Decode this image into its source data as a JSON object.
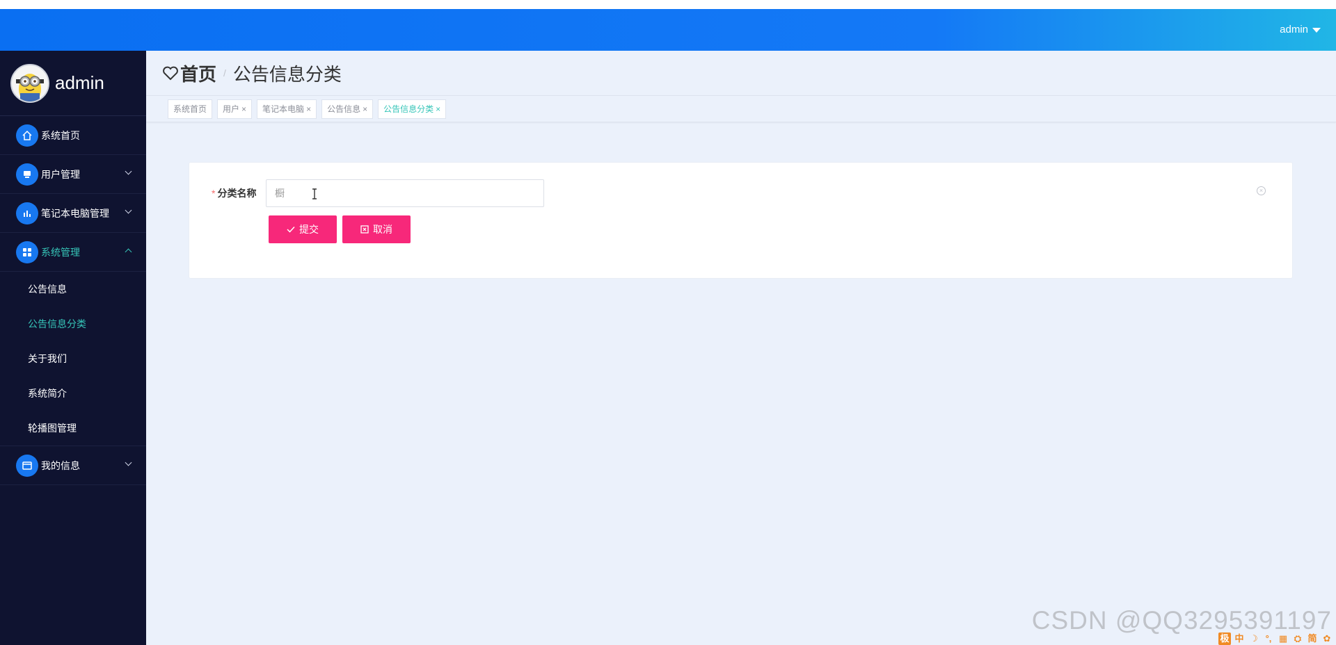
{
  "topbar": {
    "user_label": "admin"
  },
  "sidebar": {
    "profile_name": "admin",
    "items": [
      {
        "label": "系统首页",
        "icon": "home-icon"
      },
      {
        "label": "用户管理",
        "icon": "user-icon"
      },
      {
        "label": "笔记本电脑管理",
        "icon": "chart-icon"
      },
      {
        "label": "系统管理",
        "icon": "grid-icon"
      },
      {
        "label": "我的信息",
        "icon": "card-icon"
      }
    ],
    "submenu": [
      "公告信息",
      "公告信息分类",
      "关于我们",
      "系统简介",
      "轮播图管理"
    ]
  },
  "breadcrumb": {
    "home": "首页",
    "separator": "/",
    "current": "公告信息分类"
  },
  "tabs": [
    {
      "label": "系统首页",
      "closable": false
    },
    {
      "label": "用户",
      "closable": true
    },
    {
      "label": "笔记本电脑",
      "closable": true
    },
    {
      "label": "公告信息",
      "closable": true
    },
    {
      "label": "公告信息分类",
      "closable": true,
      "active": true
    }
  ],
  "tab_close_glyph": "×",
  "form": {
    "field_label": "分类名称",
    "required_mark": "*",
    "field_value": "橱",
    "submit_label": "提交",
    "cancel_label": "取消"
  },
  "watermark": "CSDN @QQ3295391197",
  "ime_bar": [
    "极",
    "中",
    "☽",
    "°,",
    "▦",
    "⛭",
    "简",
    "✿"
  ],
  "colors": {
    "accent": "#1878f0",
    "active_teal": "#36c5b8",
    "button_pink": "#f7287a",
    "sidebar_bg": "#0f1330",
    "main_bg": "#ebf1fb"
  }
}
